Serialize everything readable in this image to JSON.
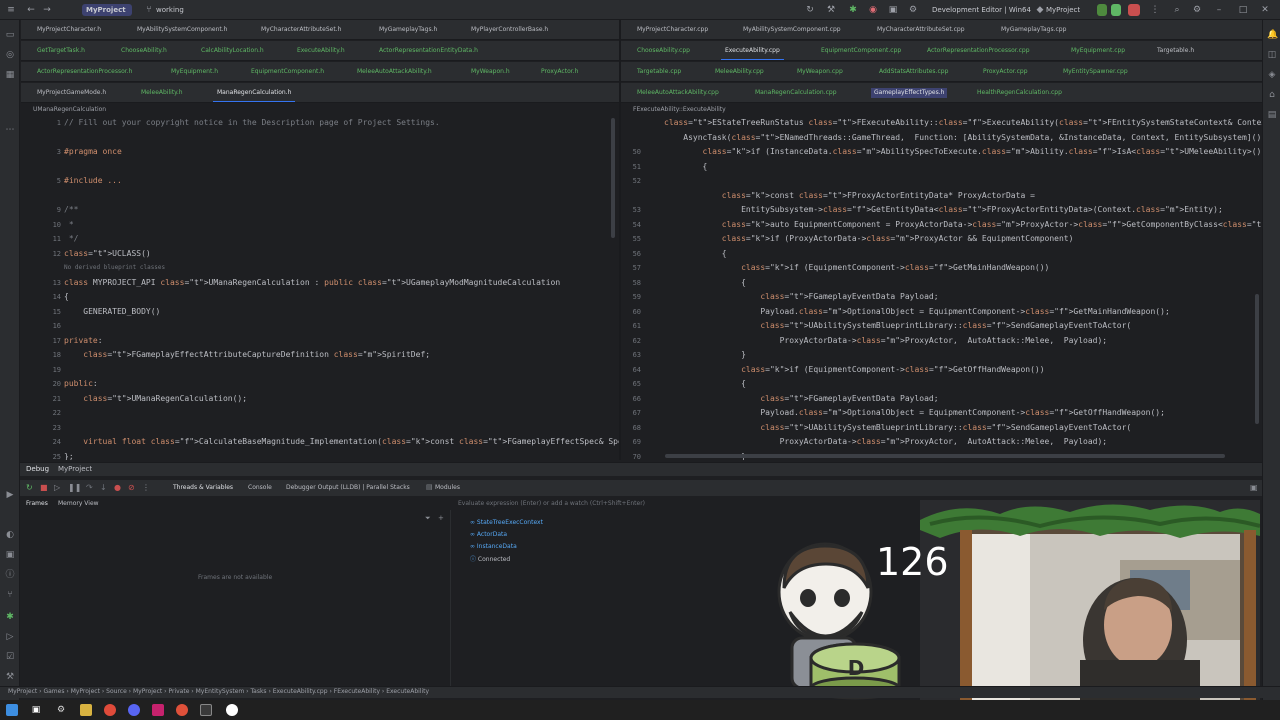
{
  "titlebar": {
    "project": "MyProject",
    "branch": "working",
    "config": "Development Editor | Win64",
    "run_target": "MyProject"
  },
  "left_tabs": {
    "row1": [
      "MyProjectCharacter.h",
      "MyAbilitySystemComponent.h",
      "MyCharacterAttributeSet.h",
      "MyGameplayTags.h",
      "MyPlayerControllerBase.h"
    ],
    "row2": [
      "GetTargetTask.h",
      "ChooseAbility.h",
      "CalcAbilityLocation.h",
      "ExecuteAbility.h",
      "ActorRepresentationEntityData.h"
    ],
    "row3": [
      "ActorRepresentationProcessor.h",
      "MyEquipment.h",
      "EquipmentComponent.h",
      "MeleeAutoAttackAbility.h",
      "MyWeapon.h",
      "ProxyActor.h"
    ],
    "row4": [
      "MyProjectGameMode.h",
      "MeleeAbility.h",
      "ManaRegenCalculation.h"
    ],
    "active": "ManaRegenCalculation.h"
  },
  "right_tabs": {
    "row1": [
      "MyProjectCharacter.cpp",
      "MyAbilitySystemComponent.cpp",
      "MyCharacterAttributeSet.cpp",
      "MyGameplayTags.cpp"
    ],
    "row2": [
      "ChooseAbility.cpp",
      "ExecuteAbility.cpp",
      "EquipmentComponent.cpp",
      "ActorRepresentationProcessor.cpp",
      "MyEquipment.cpp",
      "Targetable.h"
    ],
    "row3": [
      "Targetable.cpp",
      "MeleeAbility.cpp",
      "MyWeapon.cpp",
      "AddStatsAttributes.cpp",
      "ProxyActor.cpp",
      "MyEntitySpawner.cpp"
    ],
    "row4": [
      "MeleeAutoAttackAbility.cpp",
      "ManaRegenCalculation.cpp",
      "GameplayEffectTypes.h",
      "HealthRegenCalculation.cpp"
    ],
    "active": "ExecuteAbility.cpp"
  },
  "left_editor": {
    "breadcrumb": "UManaRegenCalculation",
    "line_numbers": [
      "1",
      "",
      "3",
      "",
      "5",
      "",
      "9",
      "10",
      "11",
      "12",
      "",
      "13",
      "14",
      "15",
      "16",
      "17",
      "18",
      "19",
      "20",
      "21",
      "22",
      "23",
      "24",
      "25"
    ],
    "lines": [
      "// Fill out your copyright notice in the Description page of Project Settings.",
      "",
      "#pragma once",
      "",
      "#include ...",
      "",
      "/**",
      " *",
      " */",
      "UCLASS()",
      "No derived blueprint classes",
      "class MYPROJECT_API UManaRegenCalculation : public UGameplayModMagnitudeCalculation",
      "{",
      "    GENERATED_BODY()",
      "",
      "private:",
      "    FGameplayEffectAttributeCaptureDefinition SpiritDef;",
      "",
      "public:",
      "    UManaRegenCalculation();",
      "",
      "",
      "    virtual float CalculateBaseMagnitude_Implementation(const FGameplayEffectSpec& Spec) const override;",
      "};"
    ]
  },
  "right_editor": {
    "breadcrumb": "FExecuteAbility::ExecuteAbility",
    "line_numbers": [
      "",
      "",
      "50",
      "51",
      "52",
      "",
      "53",
      "54",
      "55",
      "56",
      "57",
      "58",
      "59",
      "60",
      "61",
      "62",
      "63",
      "64",
      "65",
      "66",
      "67",
      "68",
      "69",
      "70",
      "71",
      "72"
    ],
    "lines": [
      "EStateTreeRunStatus FExecuteAbility::ExecuteAbility(FEntitySystemStateContext& Context) const",
      "    AsyncTask(ENamedThreads::GameThread,  Function: [AbilitySystemData, &InstanceData, Context, EntitySubsystem]() -> void",
      "        if (InstanceData.AbilitySpecToExecute.Ability.IsA<UMeleeAbility>())",
      "        {",
      "",
      "            const FProxyActorEntityData* ProxyActorData =",
      "                EntitySubsystem->GetEntityData<FProxyActorEntityData>(Context.Entity);",
      "            auto EquipmentComponent = ProxyActorData->ProxyActor->GetComponentByClass<UEquipmentComponent>();",
      "            if (ProxyActorData->ProxyActor && EquipmentComponent)",
      "            {",
      "                if (EquipmentComponent->GetMainHandWeapon())",
      "                {",
      "                    FGameplayEventData Payload;",
      "                    Payload.OptionalObject = EquipmentComponent->GetMainHandWeapon();",
      "                    UAbilitySystemBlueprintLibrary::SendGameplayEventToActor(",
      "                        ProxyActorData->ProxyActor,  AutoAttack::Melee,  Payload);",
      "                }",
      "                if (EquipmentComponent->GetOffHandWeapon())",
      "                {",
      "                    FGameplayEventData Payload;",
      "                    Payload.OptionalObject = EquipmentComponent->GetOffHandWeapon();",
      "                    UAbilitySystemBlueprintLibrary::SendGameplayEventToActor(",
      "                        ProxyActorData->ProxyActor,  AutoAttack::Melee,  Payload);",
      "                }",
      "            }"
    ]
  },
  "debug": {
    "tab_label": "Debug",
    "config": "MyProject",
    "tool_tabs": [
      "Threads & Variables",
      "Console",
      "Debugger Output (LLDB) | Parallel Stacks",
      "Modules"
    ],
    "sub_tabs": [
      "Frames",
      "Memory View"
    ],
    "frames_empty": "Frames are not available",
    "eval_placeholder": "Evaluate expression (Enter) or add a watch (Ctrl+Shift+Enter)",
    "variables": [
      "StateTreeExecContext",
      "ActorData",
      "InstanceData",
      "Connected"
    ]
  },
  "status": {
    "path": [
      "MyProject",
      "Games",
      "MyProject",
      "Source",
      "MyProject",
      "Private",
      "MyEntitySystem",
      "Tasks",
      "ExecuteAbility.cpp",
      "FExecuteAbility",
      "ExecuteAbility"
    ]
  },
  "overlay": {
    "counter": "126",
    "mascot_letter": "D"
  },
  "colors": {
    "accent": "#3574f0",
    "editor_bg": "#1e1f22",
    "panel_bg": "#2b2d30"
  }
}
